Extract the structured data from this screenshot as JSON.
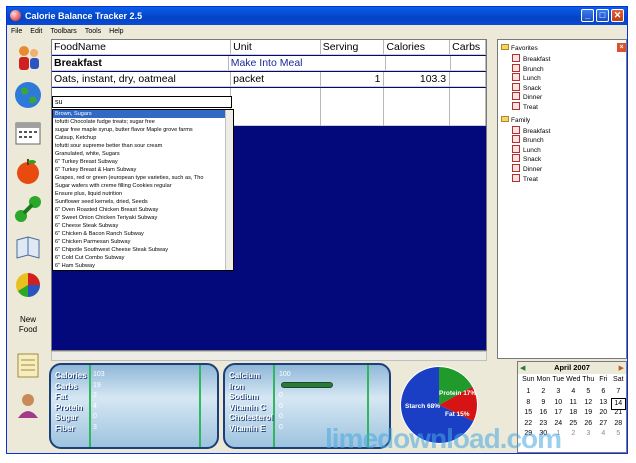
{
  "window": {
    "title": "Calorie Balance Tracker 2.5"
  },
  "menu": [
    "File",
    "Edit",
    "Toolbars",
    "Tools",
    "Help"
  ],
  "sidebar": {
    "new_food_label": "New\nFood"
  },
  "grid": {
    "headers": [
      "FoodName",
      "Unit",
      "Serving",
      "Calories",
      "Carbs"
    ],
    "meal_row": {
      "name": "Breakfast",
      "action": "Make Into Meal"
    },
    "food_row": {
      "name": "Oats, instant, dry, oatmeal",
      "unit": "packet",
      "serving": "1",
      "calories": "103.3"
    }
  },
  "autocomplete": {
    "input_value": "su",
    "items": [
      "Brown, Sugars",
      "tofutti Chocolate fudge treats; sugar free",
      "sugar free maple syrup, butter flavor Maple grove farms",
      "Catsup, Ketchup",
      "tofutti sour supreme better than sour cream",
      "Granulated, white, Sugars",
      "6\" Turkey Breast Subway",
      "6\" Turkey Breast & Ham Subway",
      "Grapes, red or green (european type varieties, such as, Tho",
      "Sugar wafers with creme filling Cookies regular",
      "Ensure plus, liquid nutrition",
      "Sunflower seed kernels, dried, Seeds",
      "6\" Oven Roasted Chicken Breast Subway",
      "6\" Sweet Onion Chicken Teriyaki Subway",
      "6\" Cheese Steak Subway",
      "6\" Chicken & Bacon Ranch Subway",
      "6\" Chicken Parmesan Subway",
      "6\" Chipotle Southwest Cheese Steak Subway",
      "6\" Cold Cut Combo Subway",
      "6\" Ham Subway"
    ],
    "selected_index": 0
  },
  "tree": {
    "favorites": {
      "label": "Favorites",
      "items": [
        "Breakfast",
        "Brunch",
        "Lunch",
        "Snack",
        "Dinner",
        "Treat"
      ]
    },
    "family": {
      "label": "Family",
      "items": [
        "Breakfast",
        "Brunch",
        "Lunch",
        "Snack",
        "Dinner",
        "Treat"
      ]
    }
  },
  "nutrients_left": {
    "labels": [
      "Calories",
      "Carbs",
      "Fat",
      "Protein",
      "Sugar",
      "Fiber"
    ],
    "values": [
      "103",
      "19",
      "2",
      "4",
      "0",
      "3"
    ]
  },
  "nutrients_right": {
    "labels": [
      "Calcium",
      "Iron",
      "Sodium",
      "Vitamin C",
      "Cholesterol",
      "Vitamin E"
    ],
    "values": [
      "100",
      "",
      "0",
      "0",
      "0",
      "0"
    ]
  },
  "macro_pie": {
    "slices": [
      {
        "name": "Starch",
        "percent": 68,
        "color": "#1a3fc4"
      },
      {
        "name": "Protein",
        "percent": 17,
        "color": "#1f9a2b"
      },
      {
        "name": "Fat",
        "percent": 15,
        "color": "#d61414"
      }
    ],
    "labels": {
      "starch": "Starch 68%",
      "protein": "Protein 17%",
      "fat": "Fat 15%"
    }
  },
  "calendar": {
    "title": "April 2007",
    "dow": [
      "Sun",
      "Mon",
      "Tue",
      "Wed",
      "Thu",
      "Fri",
      "Sat"
    ],
    "weeks": [
      [
        "1",
        "2",
        "3",
        "4",
        "5",
        "6",
        "7"
      ],
      [
        "8",
        "9",
        "10",
        "11",
        "12",
        "13",
        "14"
      ],
      [
        "15",
        "16",
        "17",
        "18",
        "19",
        "20",
        "21"
      ],
      [
        "22",
        "23",
        "24",
        "25",
        "26",
        "27",
        "28"
      ],
      [
        "29",
        "30",
        "1",
        "2",
        "3",
        "4",
        "5"
      ]
    ],
    "today": "14"
  },
  "watermark": "limedownload.com"
}
